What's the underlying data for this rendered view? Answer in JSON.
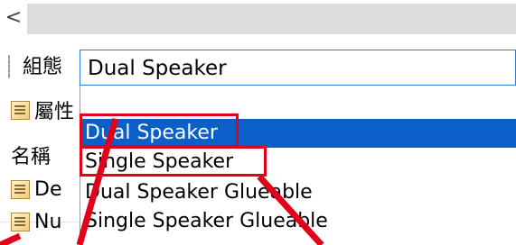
{
  "toolbar": {
    "back_icon": "chevron-left-icon",
    "back_glyph": "<"
  },
  "config": {
    "label": "組態",
    "value": "Dual Speaker"
  },
  "left_panel": {
    "properties_label": "屬性",
    "name_label": "名稱",
    "row1_label": "De",
    "row2_label": "Nu"
  },
  "dropdown": {
    "options": [
      {
        "label": ""
      },
      {
        "label": "Dual Speaker",
        "selected": true
      },
      {
        "label": "Single Speaker"
      },
      {
        "label": "Dual Speaker Glueable"
      },
      {
        "label": "Single Speaker Glueable"
      }
    ]
  },
  "colors": {
    "highlight": "#e3001b",
    "selection": "#0a5fc9",
    "focus_border": "#2b79d8"
  }
}
